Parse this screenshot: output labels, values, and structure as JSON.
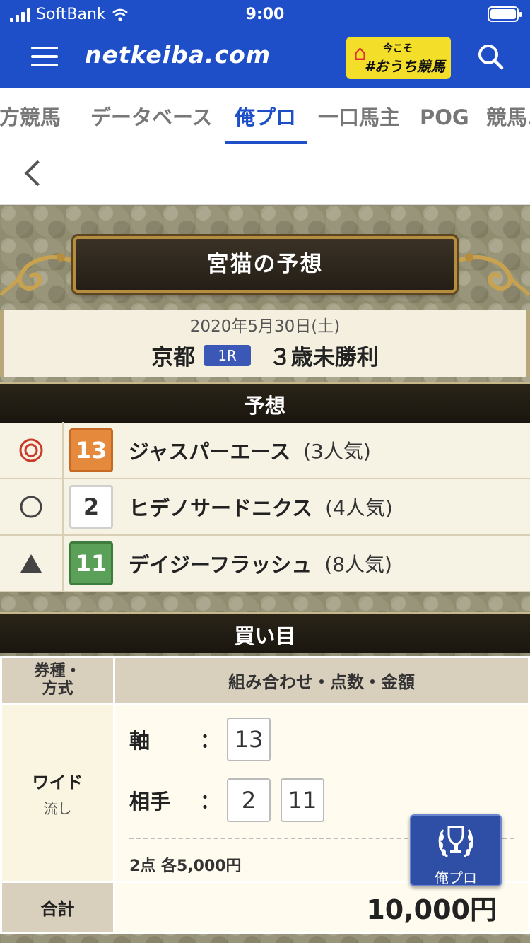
{
  "status": {
    "carrier": "SoftBank",
    "time": "9:00"
  },
  "header": {
    "logo": "netkeiba.com",
    "promo_line1": "今こそ",
    "promo_line2": "#おうち競馬"
  },
  "tabs": [
    {
      "label": "地方競馬"
    },
    {
      "label": "データベース"
    },
    {
      "label": "俺プロ",
      "active": true
    },
    {
      "label": "一口馬主"
    },
    {
      "label": "POG"
    },
    {
      "label": "競馬ニ"
    }
  ],
  "prediction": {
    "title": "宮猫の予想",
    "date": "2020年5月30日(土)",
    "venue": "京都",
    "race_no": "1R",
    "race_name": "３歳未勝利"
  },
  "picks_section": {
    "title": "予想"
  },
  "picks": [
    {
      "mark": "double-circle",
      "number": "13",
      "color": "orange",
      "name": "ジャスパーエース",
      "popularity": "(3人気)"
    },
    {
      "mark": "circle",
      "number": "2",
      "color": "white",
      "name": "ヒデノサードニクス",
      "popularity": "(4人気)"
    },
    {
      "mark": "triangle",
      "number": "11",
      "color": "green",
      "name": "デイジーフラッシュ",
      "popularity": "(8人気)"
    }
  ],
  "bets_section": {
    "title": "買い目"
  },
  "bets": {
    "header_type": "券種・方式",
    "header_type_l1": "券種・",
    "header_type_l2": "方式",
    "header_combo": "組み合わせ・点数・金額",
    "type": "ワイド",
    "method": "流し",
    "axis_label": "軸",
    "colon": "：",
    "axis": [
      "13"
    ],
    "partner_label": "相手",
    "partners": [
      "2",
      "11"
    ],
    "points": "2点 各5,000円",
    "total_label": "合計",
    "total": "10,000円"
  },
  "fab": {
    "label": "俺プロ"
  },
  "colors": {
    "brand": "#1e4fc8",
    "orange": "#e58a3c",
    "green": "#5aa058",
    "mark_red": "#c93a2a"
  }
}
